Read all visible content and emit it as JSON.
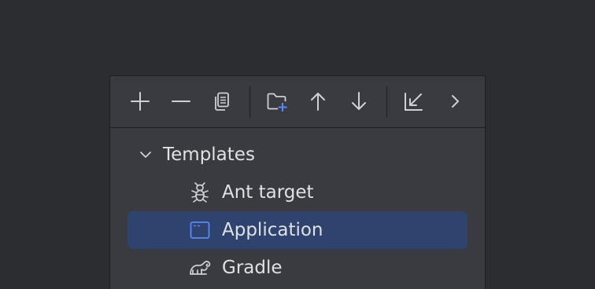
{
  "toolbar": {
    "buttons": [
      {
        "icon": "plus-icon"
      },
      {
        "icon": "minus-icon"
      },
      {
        "icon": "copy-icon"
      },
      {
        "icon": "new-folder-icon"
      },
      {
        "icon": "arrow-up-icon"
      },
      {
        "icon": "arrow-down-icon"
      },
      {
        "icon": "collapse-icon"
      },
      {
        "icon": "chevron-right-icon"
      }
    ]
  },
  "tree": {
    "group_label": "Templates",
    "expanded": true,
    "items": [
      {
        "label": "Ant target",
        "icon": "ant-icon",
        "selected": false
      },
      {
        "label": "Application",
        "icon": "application-icon",
        "selected": true
      },
      {
        "label": "Gradle",
        "icon": "gradle-icon",
        "selected": false
      }
    ]
  },
  "colors": {
    "background": "#2b2d30",
    "panel": "#393b40",
    "selection": "#2e436e",
    "text": "#dfe1e5",
    "icon": "#ced0d6",
    "accent": "#548af7"
  }
}
